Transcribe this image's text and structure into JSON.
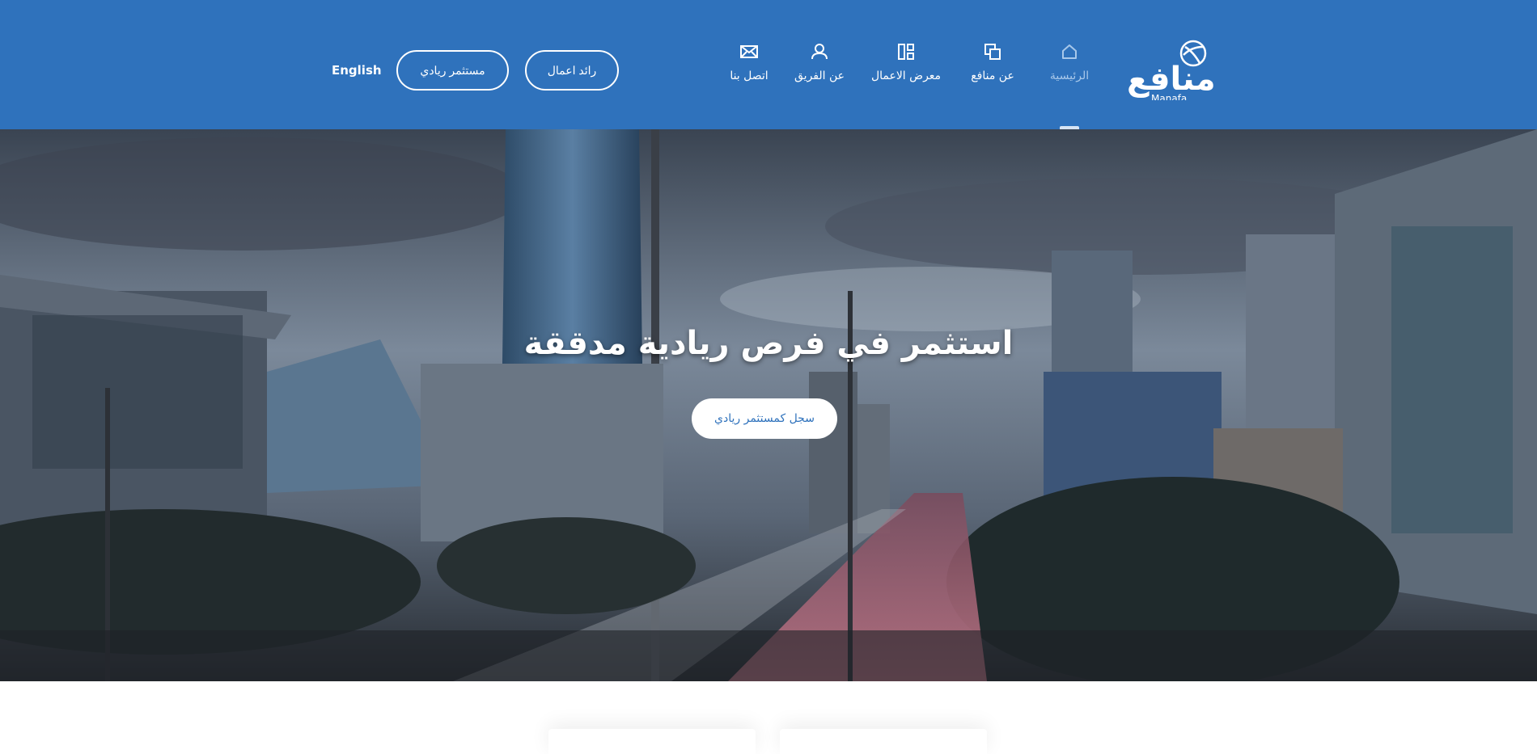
{
  "brand": {
    "name_ar": "منافع",
    "name_en": "Manafa"
  },
  "nav": {
    "items": [
      {
        "label": "الرئيسية",
        "icon": "home-icon",
        "active": true
      },
      {
        "label": "عن منافع",
        "icon": "copy-icon",
        "active": false
      },
      {
        "label": "معرض الاعمال",
        "icon": "dashboard-icon",
        "active": false
      },
      {
        "label": "عن الفريق",
        "icon": "user-icon",
        "active": false
      },
      {
        "label": "اتصل بنا",
        "icon": "mail-icon",
        "active": false
      }
    ]
  },
  "actions": {
    "entrepreneur": "رائد اعمال",
    "investor": "مستثمر ريادي",
    "language": "English"
  },
  "hero": {
    "title": "استثمر في فرص ريادية مدققة",
    "cta": "سجل كمستثمر ريادي"
  },
  "colors": {
    "primary": "#2f72bc",
    "active_nav": "#a8c8ea",
    "white": "#ffffff"
  }
}
